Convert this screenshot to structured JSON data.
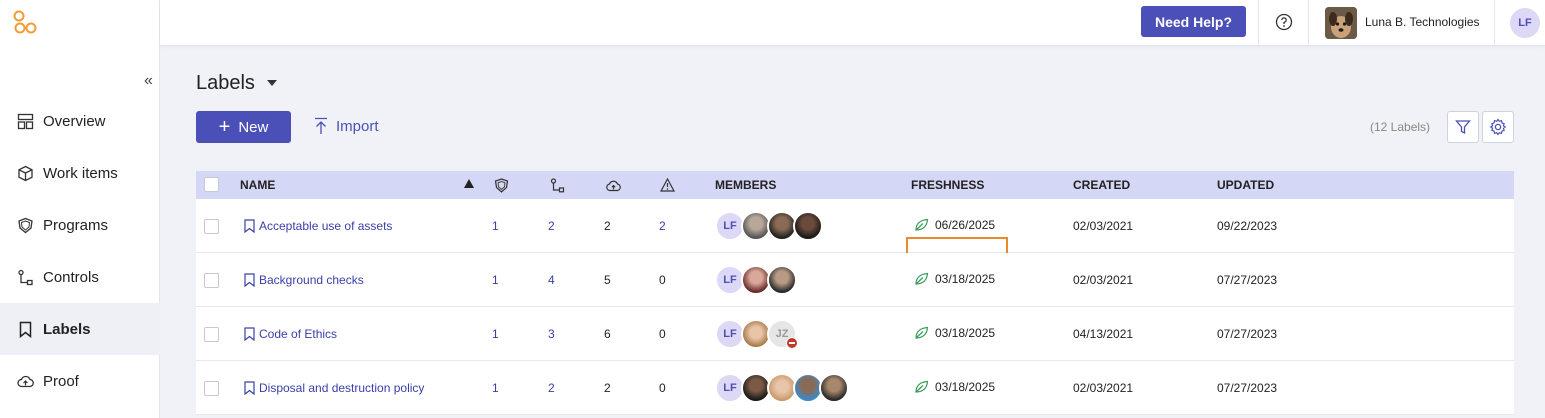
{
  "sidebar": {
    "collapse_icon": "double-chevron-left-icon",
    "items": [
      {
        "label": "Overview",
        "icon": "dashboard-icon"
      },
      {
        "label": "Work items",
        "icon": "box-icon"
      },
      {
        "label": "Programs",
        "icon": "shield-icon"
      },
      {
        "label": "Controls",
        "icon": "flow-icon"
      },
      {
        "label": "Labels",
        "icon": "bookmark-icon",
        "active": true
      },
      {
        "label": "Proof",
        "icon": "cloud-icon"
      }
    ]
  },
  "topbar": {
    "help_label": "Need Help?",
    "org_name": "Luna B. Technologies",
    "user_initials": "LF"
  },
  "page": {
    "title": "Labels",
    "new_label": "New",
    "import_label": "Import",
    "count": "(12 Labels)"
  },
  "table": {
    "headers": {
      "name": "NAME",
      "members": "MEMBERS",
      "freshness": "FRESHNESS",
      "created": "CREATED",
      "updated": "UPDATED"
    },
    "rows": [
      {
        "name": "Acceptable use of assets",
        "programs": "1",
        "controls": "2",
        "proof": "2",
        "issues": "2",
        "freshness": "06/26/2025",
        "created": "02/03/2021",
        "updated": "09/22/2023",
        "members": [
          "LF",
          "photo",
          "photo",
          "photo"
        ]
      },
      {
        "name": "Background checks",
        "programs": "1",
        "controls": "4",
        "proof": "5",
        "issues": "0",
        "freshness": "03/18/2025",
        "created": "02/03/2021",
        "updated": "07/27/2023",
        "members": [
          "LF",
          "photo",
          "photo"
        ]
      },
      {
        "name": "Code of Ethics",
        "programs": "1",
        "controls": "3",
        "proof": "6",
        "issues": "0",
        "freshness": "03/18/2025",
        "created": "04/13/2021",
        "updated": "07/27/2023",
        "members": [
          "LF",
          "photo",
          "JZ"
        ]
      },
      {
        "name": "Disposal and destruction policy",
        "programs": "1",
        "controls": "2",
        "proof": "2",
        "issues": "0",
        "freshness": "03/18/2025",
        "created": "02/03/2021",
        "updated": "07/27/2023",
        "members": [
          "LF",
          "photo",
          "photo",
          "photo",
          "photo"
        ]
      }
    ]
  },
  "colors": {
    "accent": "#4a50b7",
    "header_bg": "#d4d7f5",
    "highlight": "#e8892b",
    "freshness_leaf": "#3a9a5a"
  }
}
